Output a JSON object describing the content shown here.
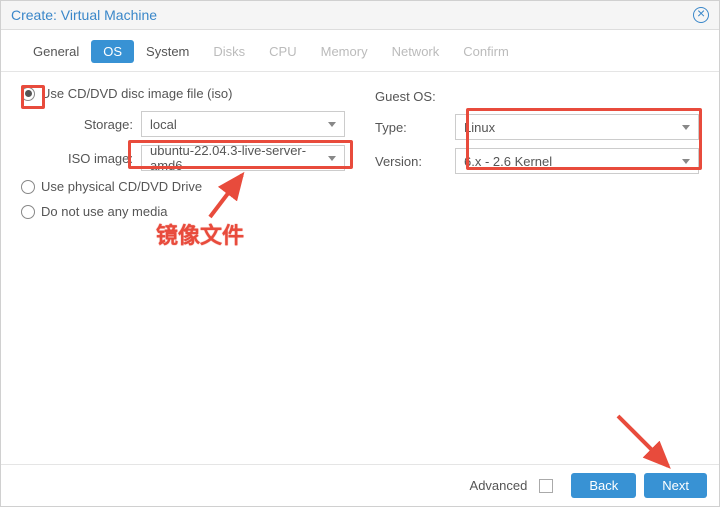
{
  "titlebar": {
    "title": "Create: Virtual Machine"
  },
  "tabs": [
    {
      "label": "General"
    },
    {
      "label": "OS"
    },
    {
      "label": "System"
    },
    {
      "label": "Disks"
    },
    {
      "label": "CPU"
    },
    {
      "label": "Memory"
    },
    {
      "label": "Network"
    },
    {
      "label": "Confirm"
    }
  ],
  "left": {
    "radio_iso": "Use CD/DVD disc image file (iso)",
    "storage_label": "Storage:",
    "storage_value": "local",
    "iso_label": "ISO image:",
    "iso_value": "ubuntu-22.04.3-live-server-amd6",
    "radio_physical": "Use physical CD/DVD Drive",
    "radio_none": "Do not use any media"
  },
  "right": {
    "guest_os": "Guest OS:",
    "type_label": "Type:",
    "type_value": "Linux",
    "version_label": "Version:",
    "version_value": "6.x - 2.6 Kernel"
  },
  "footer": {
    "advanced": "Advanced",
    "back": "Back",
    "next": "Next"
  },
  "annotation": {
    "text": "镜像文件"
  }
}
